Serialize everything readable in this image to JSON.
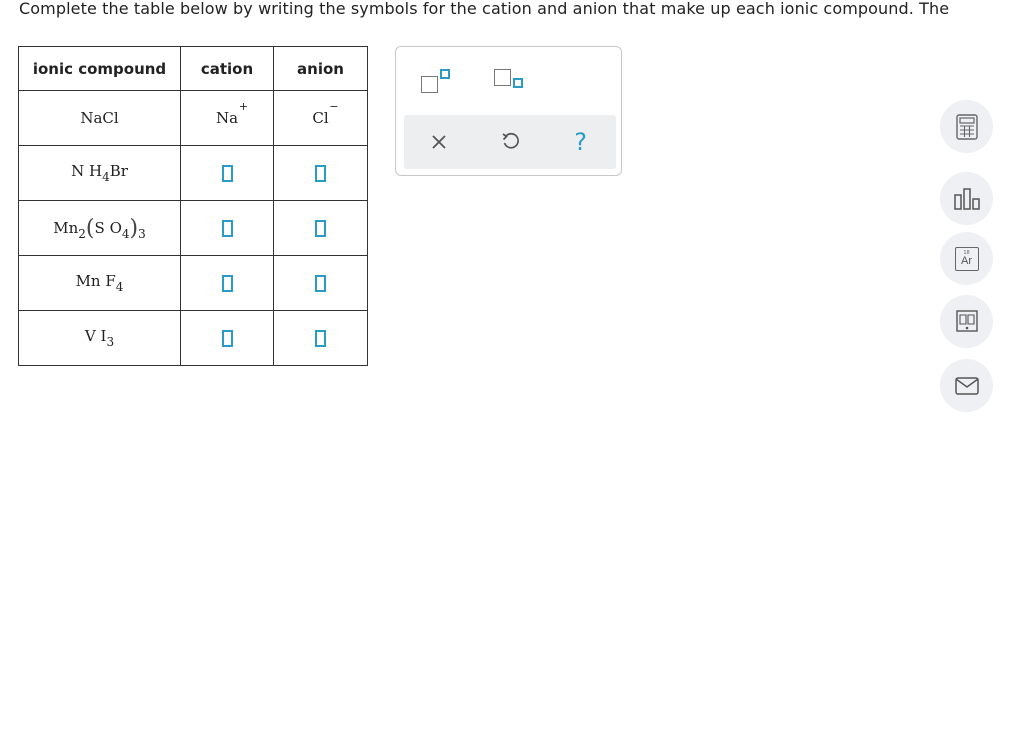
{
  "instruction": "Complete the table below by writing the symbols for the cation and anion that make up each ionic compound. The",
  "table": {
    "headers": [
      "ionic compound",
      "cation",
      "anion"
    ],
    "rows": [
      {
        "compound": "NaCl",
        "cation": "Na",
        "cation_charge": "+",
        "anion": "Cl",
        "anion_charge": "−"
      },
      {
        "compound": "NH4Br",
        "cation": "",
        "anion": ""
      },
      {
        "compound": "Mn2(SO4)3",
        "cation": "",
        "anion": ""
      },
      {
        "compound": "MnF4",
        "cation": "",
        "anion": ""
      },
      {
        "compound": "VI3",
        "cation": "",
        "anion": ""
      }
    ],
    "formula_parts": {
      "row0": {
        "a": "Na",
        "b": "Cl"
      },
      "row1": {
        "a": "N",
        "b": "H",
        "sub1": "4",
        "c": "Br"
      },
      "row2": {
        "a": "Mn",
        "sub1": "2",
        "lp": "(",
        "b": "S",
        "c": "O",
        "sub2": "4",
        "rp": ")",
        "sub3": "3"
      },
      "row3": {
        "a": "Mn",
        "b": "F",
        "sub1": "4"
      },
      "row4": {
        "a": "V",
        "b": "I",
        "sub1": "3"
      }
    }
  },
  "palette": {
    "buttons": {
      "clear": "×",
      "undo": "↺",
      "help": "?"
    }
  },
  "accent_color": "#2a9bc7",
  "sidebar_tools": [
    "calculator-icon",
    "chart-icon",
    "periodic-table-icon",
    "textbook-icon",
    "message-icon"
  ],
  "periodic_tile": {
    "number": "18",
    "symbol": "Ar"
  }
}
